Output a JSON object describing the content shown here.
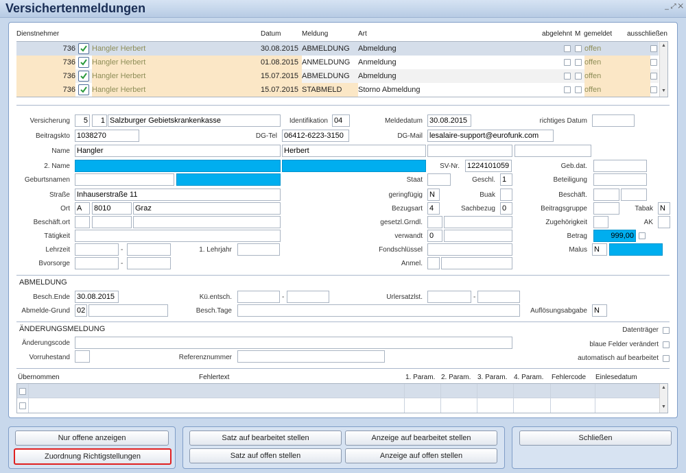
{
  "window": {
    "title": "Versichertenmeldungen",
    "controls": "_ ⤢ ✕"
  },
  "list": {
    "headers": {
      "dienstnehmer": "Dienstnehmer",
      "datum": "Datum",
      "meldung": "Meldung",
      "art": "Art",
      "abgelehnt": "abgelehnt",
      "m": "M",
      "gemeldet": "gemeldet",
      "ausschliessen": "ausschließen"
    },
    "rows": [
      {
        "nr": "736",
        "name": "Hangler Herbert",
        "datum": "30.08.2015",
        "meldung": "ABMELDUNG",
        "art": "Abmeldung",
        "gemeldet": "offen"
      },
      {
        "nr": "736",
        "name": "Hangler Herbert",
        "datum": "01.08.2015",
        "meldung": "ANMELDUNG",
        "art": "Anmeldung",
        "gemeldet": "offen"
      },
      {
        "nr": "736",
        "name": "Hangler Herbert",
        "datum": "15.07.2015",
        "meldung": "ABMELDUNG",
        "art": "Abmeldung",
        "gemeldet": "offen"
      },
      {
        "nr": "736",
        "name": "Hangler Herbert",
        "datum": "15.07.2015",
        "meldung": "STABMELD",
        "art": "Storno Abmeldung",
        "gemeldet": "offen"
      }
    ]
  },
  "form": {
    "labels": {
      "versicherung": "Versicherung",
      "identifikation": "Identifikation",
      "meldedatum": "Meldedatum",
      "richtiges_datum": "richtiges Datum",
      "beitragskto": "Beitragskto",
      "dg_tel": "DG-Tel",
      "dg_mail": "DG-Mail",
      "name": "Name",
      "name2": "2. Name",
      "sv_nr": "SV-Nr.",
      "geb_dat": "Geb.dat.",
      "geburtsnamen": "Geburtsnamen",
      "staat": "Staat",
      "geschl": "Geschl.",
      "beteiligung": "Beteiligung",
      "strasse": "Straße",
      "geringfuegig": "geringfügig",
      "buak": "Buak",
      "beschaeft": "Beschäft.",
      "ort": "Ort",
      "bezugsart": "Bezugsart",
      "sachbezug": "Sachbezug",
      "beitragsgruppe": "Beitragsgruppe",
      "tabak": "Tabak",
      "beschaeft_ort": "Beschäft.ort",
      "gesetzl_grndl": "gesetzl.Grndl.",
      "zugehoerigkeit": "Zugehörigkeit",
      "ak": "AK",
      "taetigkeit": "Tätigkeit",
      "verwandt": "verwandt",
      "betrag": "Betrag",
      "lehrzeit": "Lehrzeit",
      "lehrjahr": "1. Lehrjahr",
      "fondschluessel": "Fondschlüssel",
      "malus": "Malus",
      "bvorsorge": "Bvorsorge",
      "anmel": "Anmel.",
      "dash": "-"
    },
    "values": {
      "vers_nr": "5",
      "vers_sub": "1",
      "vers_name": "Salzburger Gebietskrankenkasse",
      "identifikation": "04",
      "meldedatum": "30.08.2015",
      "beitragskto": "1038270",
      "dg_tel": "06412-6223-3150",
      "dg_mail": "lesalaire-support@eurofunk.com",
      "nachname": "Hangler",
      "vorname": "Herbert",
      "sv_nr": "1224101059",
      "geschl": "1",
      "strasse": "Inhauserstraße 11",
      "geringfuegig": "N",
      "ort_land": "A",
      "plz": "8010",
      "ort": "Graz",
      "bezugsart": "4",
      "sachbezug": "0",
      "tabak": "N",
      "verwandt": "0",
      "betrag": "999,00",
      "malus": "N"
    }
  },
  "abmeldung": {
    "section": "ABMELDUNG",
    "labels": {
      "besch_ende": "Besch.Ende",
      "kue_entsch": "Kü.entsch.",
      "urlersatz": "Urlersatzlst.",
      "abmelde_grund": "Abmelde-Grund",
      "besch_tage": "Besch.Tage",
      "aufloesung": "Auflösungsabgabe",
      "dash": "-"
    },
    "values": {
      "besch_ende": "30.08.2015",
      "abmelde_grund": "02",
      "aufloesung": "N"
    }
  },
  "aenderung": {
    "section": "ÄNDERUNGSMELDUNG",
    "labels": {
      "aenderungscode": "Änderungscode",
      "vorruhestand": "Vorruhestand",
      "referenznummer": "Referenznummer",
      "datentraeger": "Datenträger",
      "blaue_felder": "blaue Felder verändert",
      "automatisch": "automatisch auf bearbeitet"
    }
  },
  "errors": {
    "headers": {
      "uebernommen": "Übernommen",
      "fehlertext": "Fehlertext",
      "p1": "1. Param.",
      "p2": "2. Param.",
      "p3": "3. Param.",
      "p4": "4. Param.",
      "fehlercode": "Fehlercode",
      "einlesedatum": "Einlesedatum"
    }
  },
  "buttons": {
    "nur_offene": "Nur offene anzeigen",
    "zuordnung": "Zuordnung Richtigstellungen",
    "satz_bearbeitet": "Satz auf bearbeitet stellen",
    "satz_offen": "Satz auf offen stellen",
    "anzeige_bearbeitet": "Anzeige auf bearbeitet stellen",
    "anzeige_offen": "Anzeige auf offen stellen",
    "schliessen": "Schließen"
  },
  "colors": {
    "accent_blue": "#00aeef",
    "row_highlight": "#fbe7c6",
    "selected_row": "#d5deea",
    "name_text": "#8d8d57",
    "focus_red": "#e02020"
  }
}
